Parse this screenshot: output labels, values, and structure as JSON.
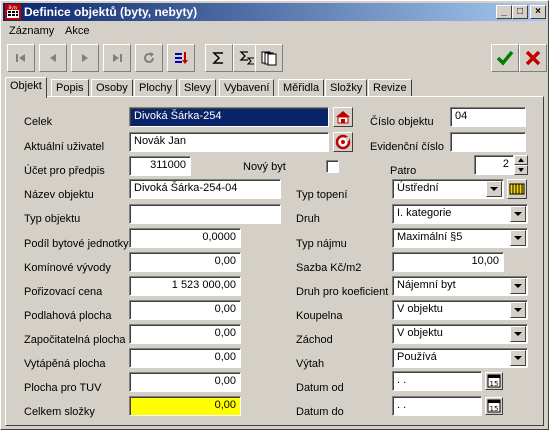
{
  "window": {
    "title": "Definice objektů (byty, nebyty)",
    "app_icon_text": "Byty",
    "minimize": "_",
    "maximize": "□",
    "close": "×"
  },
  "menu": {
    "items": [
      "Záznamy",
      "Akce"
    ]
  },
  "tabs": [
    "Objekt",
    "Popis",
    "Osoby",
    "Plochy",
    "Slevy",
    "Vybavení",
    "Měřidla",
    "Složky",
    "Revize"
  ],
  "active_tab": "Objekt",
  "form": {
    "celek_label": "Celek",
    "celek_value": "Divoká Šárka-254",
    "cislo_objektu_label": "Číslo objektu",
    "cislo_objektu_value": "04",
    "aktualni_uzivatel_label": "Aktuální uživatel",
    "aktualni_uzivatel_value": "Novák Jan",
    "evidencni_cislo_label": "Evidenční číslo",
    "evidencni_cislo_value": "",
    "ucet_label": "Účet pro předpis",
    "ucet_value": "311000",
    "novy_byt_label": "Nový byt",
    "patro_label": "Patro",
    "patro_value": "2",
    "nazev_label": "Název objektu",
    "nazev_value": "Divoká Šárka-254-04",
    "typ_objektu_label": "Typ objektu",
    "typ_objektu_value": "",
    "typ_topeni_label": "Typ topení",
    "typ_topeni_value": "Ústřední",
    "druh_label": "Druh",
    "druh_value": "I. kategorie",
    "podil_label": "Podíl bytové jednotky",
    "podil_value": "0,0000",
    "typ_najmu_label": "Typ nájmu",
    "typ_najmu_value": "Maximální §5",
    "kominove_label": "Komínové vývody",
    "kominove_value": "0,00",
    "sazba_label": "Sazba Kč/m2",
    "sazba_value": "10,00",
    "porizovaci_label": "Pořizovací cena",
    "porizovaci_value": "1 523 000,00",
    "druh_koef_label": "Druh pro koeficient",
    "druh_koef_value": "Nájemní byt",
    "podlahova_label": "Podlahová plocha",
    "podlahova_value": "0,00",
    "koupelna_label": "Koupelna",
    "koupelna_value": "V objektu",
    "zapocitatelna_label": "Započitatelná plocha",
    "zapocitatelna_value": "0,00",
    "zachod_label": "Záchod",
    "zachod_value": "V objektu",
    "vytapena_label": "Vytápěná plocha",
    "vytapena_value": "0,00",
    "vytah_label": "Výtah",
    "vytah_value": "Používá",
    "tuv_label": "Plocha pro TUV",
    "tuv_value": "0,00",
    "datum_od_label": "Datum od",
    "datum_od_value": " .  .",
    "celkem_label": "Celkem složky",
    "celkem_value": "0,00",
    "datum_do_label": "Datum do",
    "datum_do_value": " .  .",
    "calendar_badge": "15"
  },
  "colors": {
    "title_bar": "#0a246a",
    "face": "#d4d0c8",
    "highlight_field": "#ffff00",
    "selection": "#0a246a"
  },
  "icons": {
    "toolbar": [
      "first-record-icon",
      "prev-record-icon",
      "next-record-icon",
      "last-record-icon",
      "refresh-icon",
      "sort-icon",
      "sum-icon",
      "sum-sub-icon",
      "copy-pages-icon",
      "confirm-check-icon",
      "cancel-x-icon"
    ],
    "celek_button": "house-icon",
    "uzivatel_button": "person-c-icon",
    "topeni_button": "radiator-icon"
  }
}
